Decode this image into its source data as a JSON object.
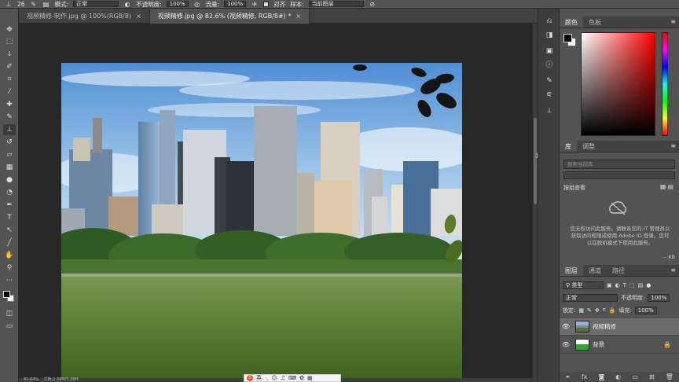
{
  "options_bar": {
    "brush_size": "26",
    "mode_label": "模式:",
    "mode_value": "正常",
    "opacity_label": "不透明度:",
    "opacity_value": "100%",
    "flow_label": "流量:",
    "flow_value": "100%",
    "aligned_label": "对齐",
    "sample_label": "样本:",
    "sample_value": "当前图层"
  },
  "tabs": [
    {
      "label": "视频精修-制作.jpg @ 100%(RGB/8)",
      "close": "×"
    },
    {
      "label": "视频精修.jpg @ 82.6% (视频精修, RGB/8#) *",
      "close": "×"
    }
  ],
  "status": {
    "zoom": "82.64%",
    "doc": "文档:2.39M/5.38M"
  },
  "ime": {
    "logo": "S",
    "lang": "英"
  },
  "color_panel": {
    "tabs": [
      "颜色",
      "色板"
    ],
    "fg": "#000000",
    "bg": "#ffffff"
  },
  "library_panel": {
    "tabs": [
      "库",
      "调整"
    ],
    "search_placeholder": "搜索当前库",
    "view_label": "按组查看",
    "message": "您无权访问此服务。请联系您的 IT 管理员以获取访问权限或使用 Adobe ID 登录。您可以在脱机模式下使用此服务。",
    "footer": "-- KB"
  },
  "layers_panel": {
    "tabs": [
      "图层",
      "通道",
      "路径"
    ],
    "filter_label": "类型",
    "blend_mode": "正常",
    "opacity_label": "不透明度:",
    "opacity_value": "100%",
    "lock_label": "锁定:",
    "fill_label": "填充:",
    "fill_value": "100%",
    "layers": [
      {
        "name": "视频精修",
        "selected": true
      },
      {
        "name": "背景",
        "selected": false
      }
    ]
  }
}
